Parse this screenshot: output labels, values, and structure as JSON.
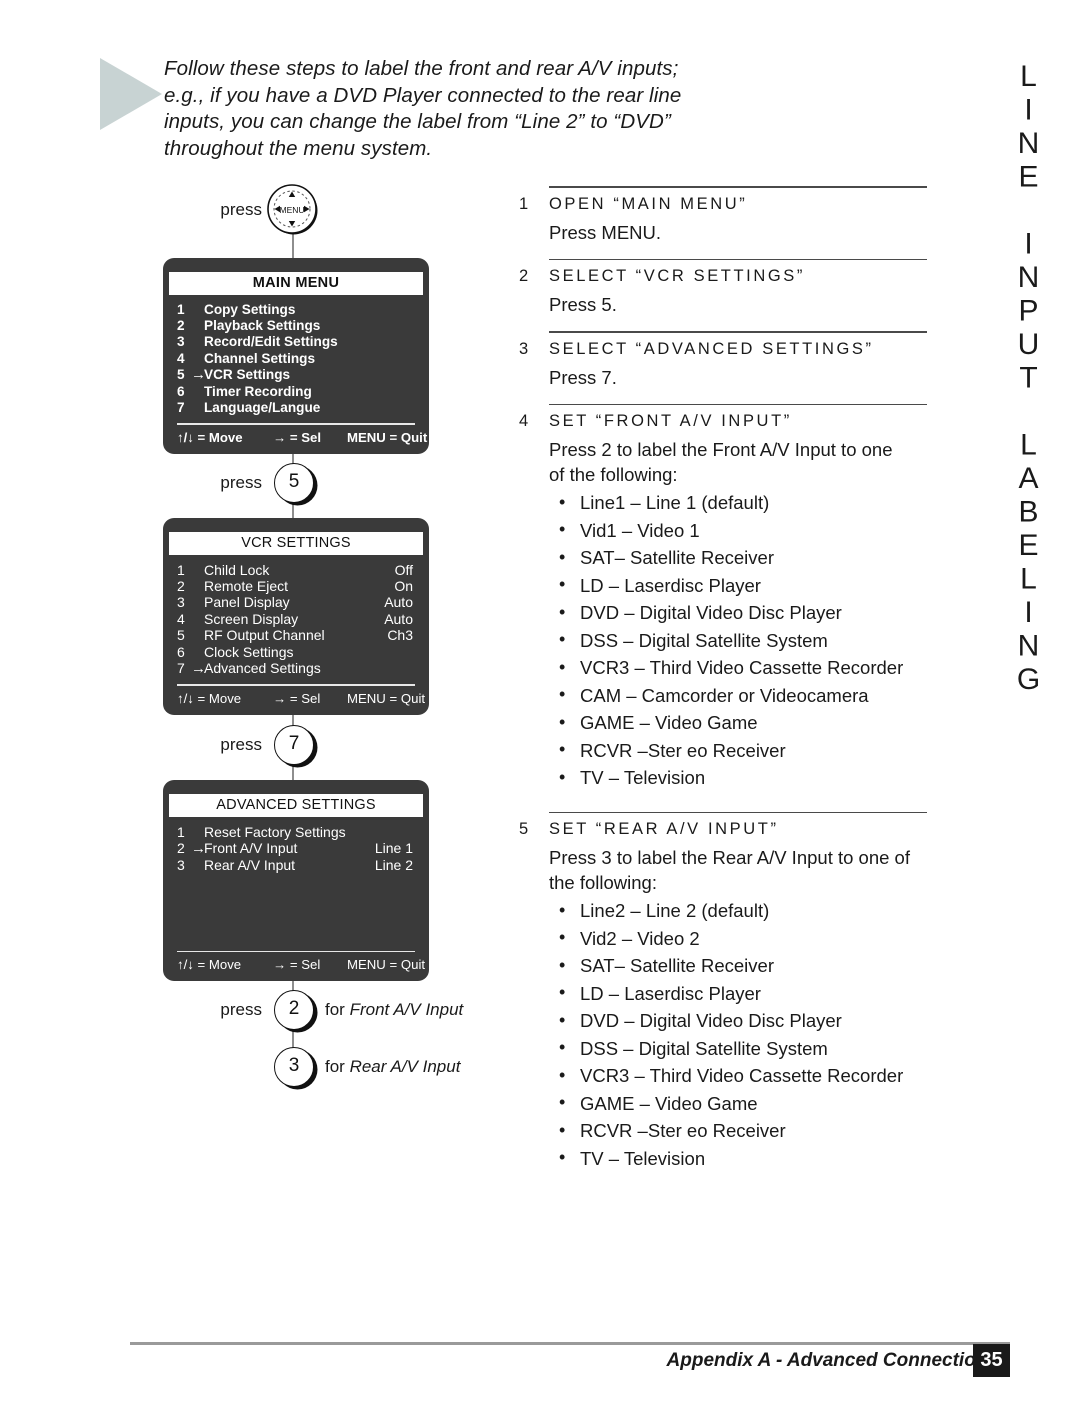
{
  "side_title": "LINE INPUT LABELING",
  "intro": {
    "lines": [
      "Follow these steps to label the front and rear A/V inputs;",
      "e.g., if you have a DVD Player connected to the rear line",
      "inputs, you can change the label from “Line 2” to “DVD”",
      "throughout the menu system."
    ]
  },
  "flow": {
    "press_menu_label": "press",
    "menu_key_label": "MENU",
    "press_5_label": "press",
    "key_5": "5",
    "press_7_label": "press",
    "key_7": "7",
    "press_2_label": "press",
    "key_2": "2",
    "key_3": "3",
    "for_front_prefix": "for ",
    "for_front_em": "Front A/V Input",
    "for_rear_prefix": "for ",
    "for_rear_em": "Rear A/V Input"
  },
  "osd": {
    "main_menu": {
      "title": "MAIN MENU",
      "rows": [
        {
          "num": "1",
          "arrow": "",
          "name": "Copy Settings",
          "value": ""
        },
        {
          "num": "2",
          "arrow": "",
          "name": "Playback Settings",
          "value": ""
        },
        {
          "num": "3",
          "arrow": "",
          "name": "Record/Edit Settings",
          "value": ""
        },
        {
          "num": "4",
          "arrow": "",
          "name": "Channel Settings",
          "value": ""
        },
        {
          "num": "5",
          "arrow": "→",
          "name": "VCR Settings",
          "value": ""
        },
        {
          "num": "6",
          "arrow": "",
          "name": "Timer Recording",
          "value": ""
        },
        {
          "num": "7",
          "arrow": "",
          "name": "Language/Langue",
          "value": ""
        }
      ],
      "footer": {
        "move": "↑/↓ = Move",
        "sel": "→ = Sel",
        "quit": "MENU = Quit"
      }
    },
    "vcr_settings": {
      "title": "VCR SETTINGS",
      "rows": [
        {
          "num": "1",
          "arrow": "",
          "name": "Child Lock",
          "value": "Off"
        },
        {
          "num": "2",
          "arrow": "",
          "name": "Remote Eject",
          "value": "On"
        },
        {
          "num": "3",
          "arrow": "",
          "name": "Panel Display",
          "value": "Auto"
        },
        {
          "num": "4",
          "arrow": "",
          "name": "Screen Display",
          "value": "Auto"
        },
        {
          "num": "5",
          "arrow": "",
          "name": "RF Output Channel",
          "value": "Ch3"
        },
        {
          "num": "6",
          "arrow": "",
          "name": "Clock Settings",
          "value": ""
        },
        {
          "num": "7",
          "arrow": "→",
          "name": "Advanced Settings",
          "value": ""
        }
      ],
      "footer": {
        "move": "↑/↓ = Move",
        "sel": "→ = Sel",
        "quit": "MENU = Quit"
      }
    },
    "advanced_settings": {
      "title": "ADVANCED SETTINGS",
      "rows": [
        {
          "num": "1",
          "arrow": "",
          "name": "Reset Factory Settings",
          "value": ""
        },
        {
          "num": "2",
          "arrow": "→",
          "name": "Front A/V Input",
          "value": "Line 1"
        },
        {
          "num": "3",
          "arrow": "",
          "name": "Rear A/V Input",
          "value": "Line 2"
        }
      ],
      "footer": {
        "move": "↑/↓ = Move",
        "sel": "→ = Sel",
        "quit": "MENU = Quit"
      }
    }
  },
  "steps": [
    {
      "num": "1",
      "title": "OPEN “MAIN MENU”",
      "body": "Press MENU.",
      "bullets": []
    },
    {
      "num": "2",
      "title": "SELECT “VCR SETTINGS”",
      "body": "Press 5.",
      "bullets": []
    },
    {
      "num": "3",
      "title": "SELECT “ADVANCED SETTINGS”",
      "body": "Press 7.",
      "bullets": []
    },
    {
      "num": "4",
      "title": "SET “FRONT A/V INPUT”",
      "body": "Press 2 to label the Front A/V Input to one\nof the following:",
      "bullets": [
        "Line1 – Line 1 (default)",
        "Vid1 – Video 1",
        "SAT– Satellite Receiver",
        "LD – Laserdisc Player",
        "DVD – Digital Video Disc Player",
        "DSS – Digital Satellite System",
        "VCR3 – Third Video Cassette Recorder",
        "CAM – Camcorder or Videocamera",
        "GAME – Video Game",
        "RCVR –Ster eo Receiver",
        "TV – Television"
      ]
    },
    {
      "num": "5",
      "title": "SET “REAR A/V INPUT”",
      "body": "Press 3 to label the Rear A/V Input to one of\nthe following:",
      "bullets": [
        "Line2 – Line 2 (default)",
        "Vid2 – Video 2",
        "SAT– Satellite Receiver",
        "LD – Laserdisc Player",
        "DVD – Digital Video Disc Player",
        "DSS – Digital Satellite System",
        "VCR3 – Third Video Cassette Recorder",
        "GAME – Video Game",
        "RCVR –Ster eo Receiver",
        "TV – Television"
      ]
    }
  ],
  "footer": {
    "text": "Appendix A - Advanced Connections",
    "page": "35"
  }
}
